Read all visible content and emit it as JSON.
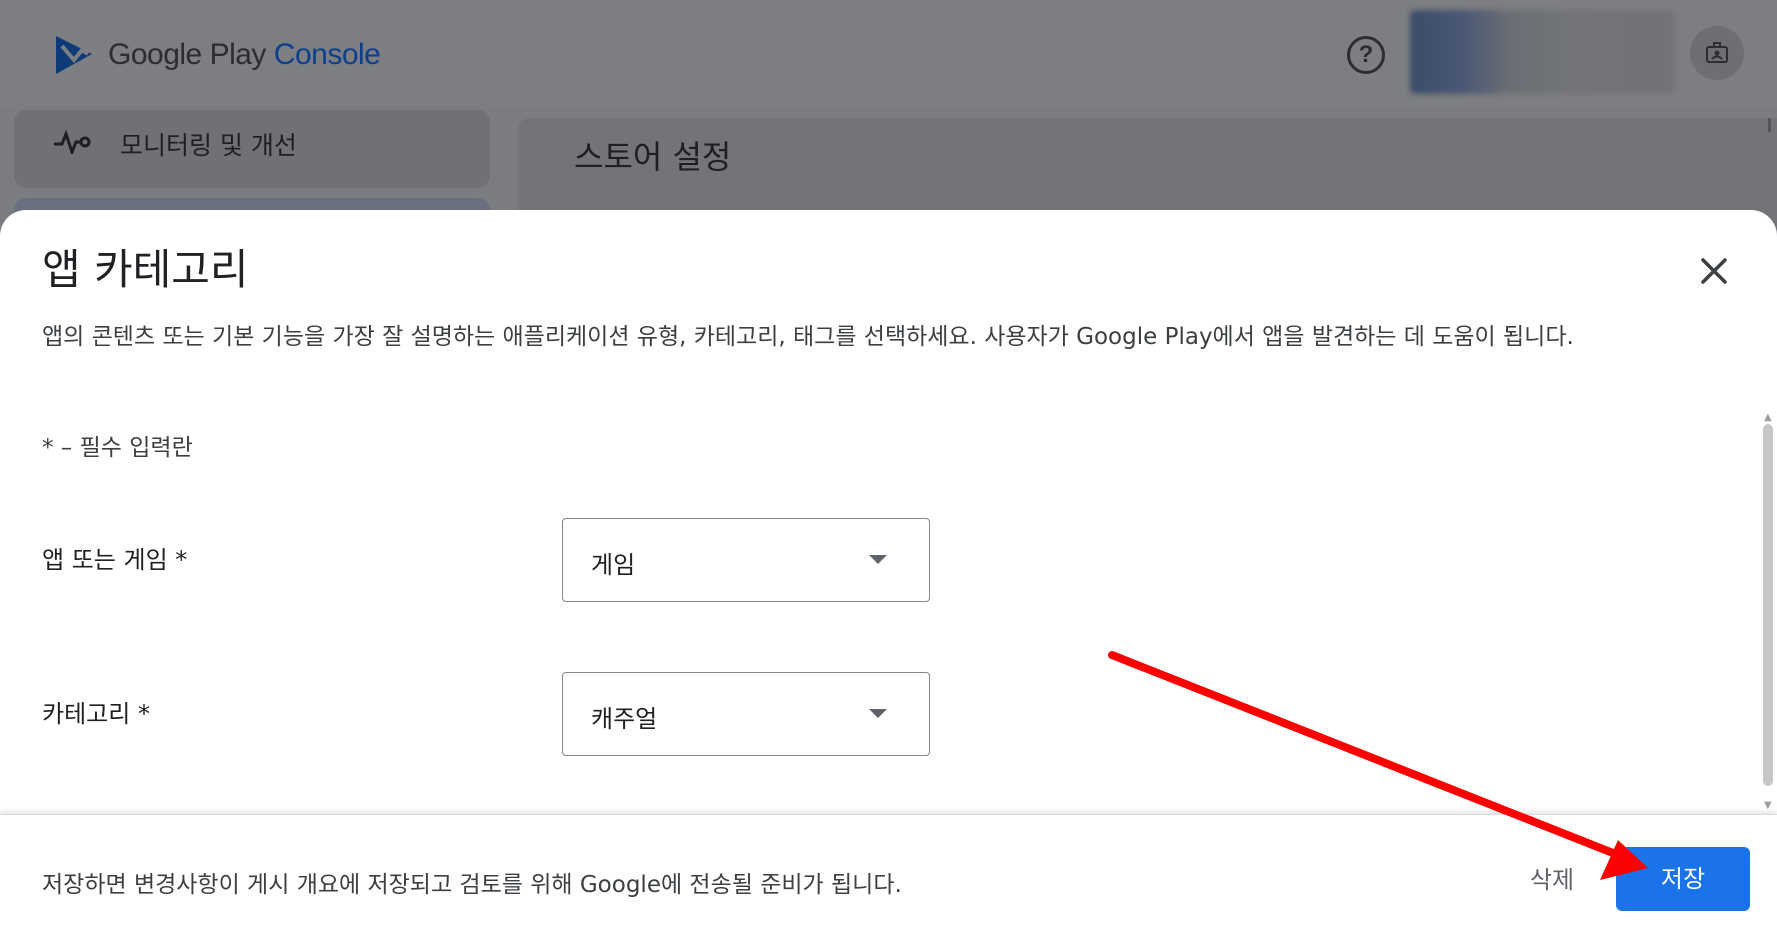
{
  "header": {
    "brand_google_play": "Google Play",
    "brand_console": "Console",
    "help_symbol": "?"
  },
  "sidebar": {
    "items": [
      {
        "label": "모니터링 및 개선",
        "icon": "pulse-icon"
      }
    ]
  },
  "main": {
    "page_title": "스토어 설정"
  },
  "dialog": {
    "title": "앱 카테고리",
    "description": "앱의 콘텐츠 또는 기본 기능을 가장 잘 설명하는 애플리케이션 유형, 카테고리, 태그를 선택하세요. 사용자가 Google Play에서 앱을 발견하는 데 도움이 됩니다.",
    "required_note": "* – 필수 입력란",
    "fields": [
      {
        "label": "앱 또는 게임  *",
        "value": "게임"
      },
      {
        "label": "카테고리  *",
        "value": "캐주얼"
      }
    ],
    "footer_note": "저장하면 변경사항이 게시 개요에 저장되고 검토를 위해 Google에 전송될 준비가 됩니다.",
    "delete_label": "삭제",
    "save_label": "저장"
  },
  "colors": {
    "primary": "#1a73e8",
    "annotation_arrow": "#ff0000",
    "overlay": "#7b7c7f"
  }
}
